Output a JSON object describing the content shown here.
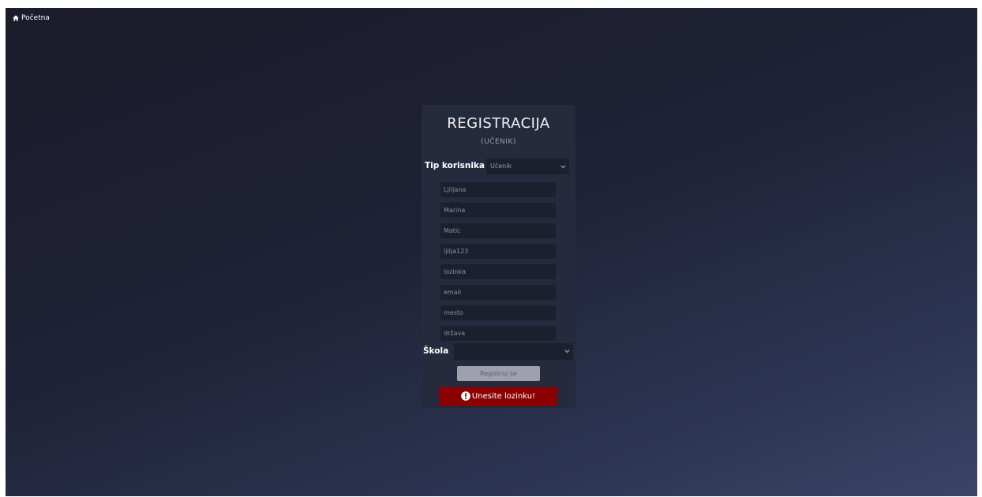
{
  "nav": {
    "home_icon": "home-icon",
    "home_label": "Početna"
  },
  "form": {
    "title": "REGISTRACIJA",
    "subtitle": "(UČENIK)",
    "user_type_label": "Tip korisnika",
    "user_type_value": "Učenik",
    "fields": [
      {
        "name": "first-name-field",
        "value": "Ljiljana"
      },
      {
        "name": "middle-name-field",
        "value": "Marina"
      },
      {
        "name": "last-name-field",
        "value": "Matic"
      },
      {
        "name": "username-field",
        "value": "ljilja123"
      },
      {
        "name": "password-field",
        "value": "lozinka"
      },
      {
        "name": "email-field",
        "value": "email"
      },
      {
        "name": "city-field",
        "value": "mesto"
      },
      {
        "name": "country-field",
        "value": "država"
      }
    ],
    "school_label": "Škola",
    "school_value": "",
    "submit_label": "Registruj se",
    "error_icon": "exclamation-circle-icon",
    "error_message": "Unesite lozinku!"
  },
  "colors": {
    "error_background": "#8b0000",
    "panel_background": "#262a3d",
    "input_background": "#1c1f2e",
    "button_background": "#9ea1ad"
  }
}
